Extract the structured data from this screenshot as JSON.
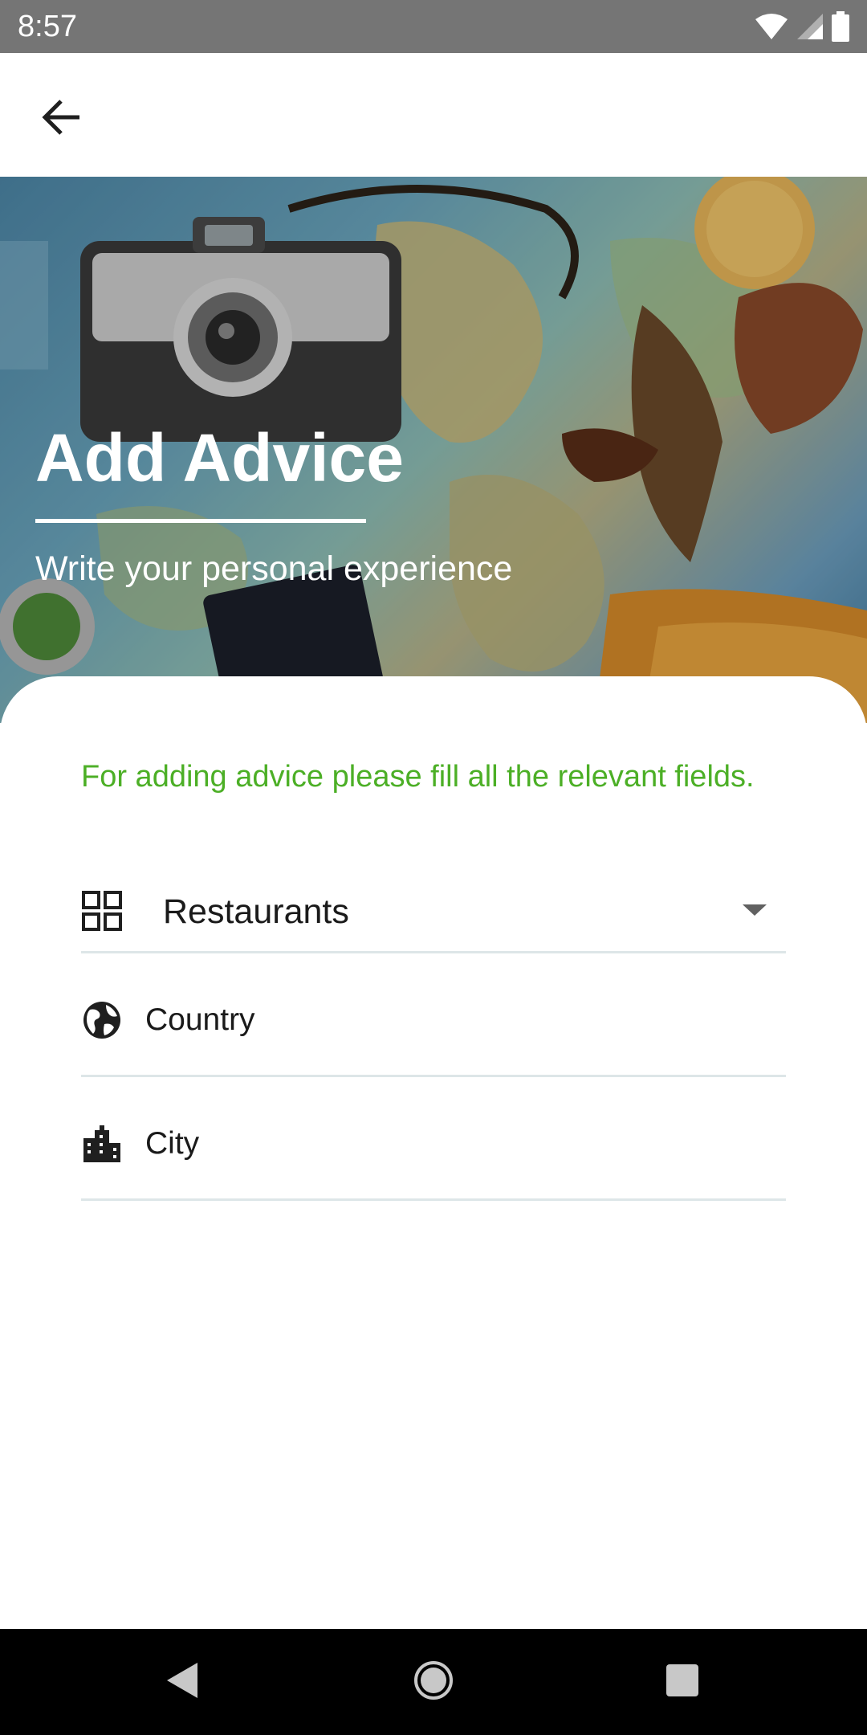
{
  "status_bar": {
    "time": "8:57",
    "icons": [
      "wifi-icon",
      "cell-signal-icon",
      "battery-icon"
    ],
    "background": "#757575"
  },
  "app_bar": {
    "back_icon": "arrow-back-icon"
  },
  "hero": {
    "title": "Add Advice",
    "subtitle": "Write your personal experience"
  },
  "form": {
    "instruction": "For adding advice please fill all the relevant fields.",
    "instruction_color": "#4caf26",
    "category": {
      "icon": "grid-icon",
      "selected": "Restaurants"
    },
    "country": {
      "icon": "globe-icon",
      "placeholder": "Country"
    },
    "city": {
      "icon": "city-icon",
      "placeholder": "City"
    }
  },
  "nav_bar": {
    "icons": [
      "nav-back-icon",
      "nav-home-icon",
      "nav-recents-icon"
    ]
  }
}
